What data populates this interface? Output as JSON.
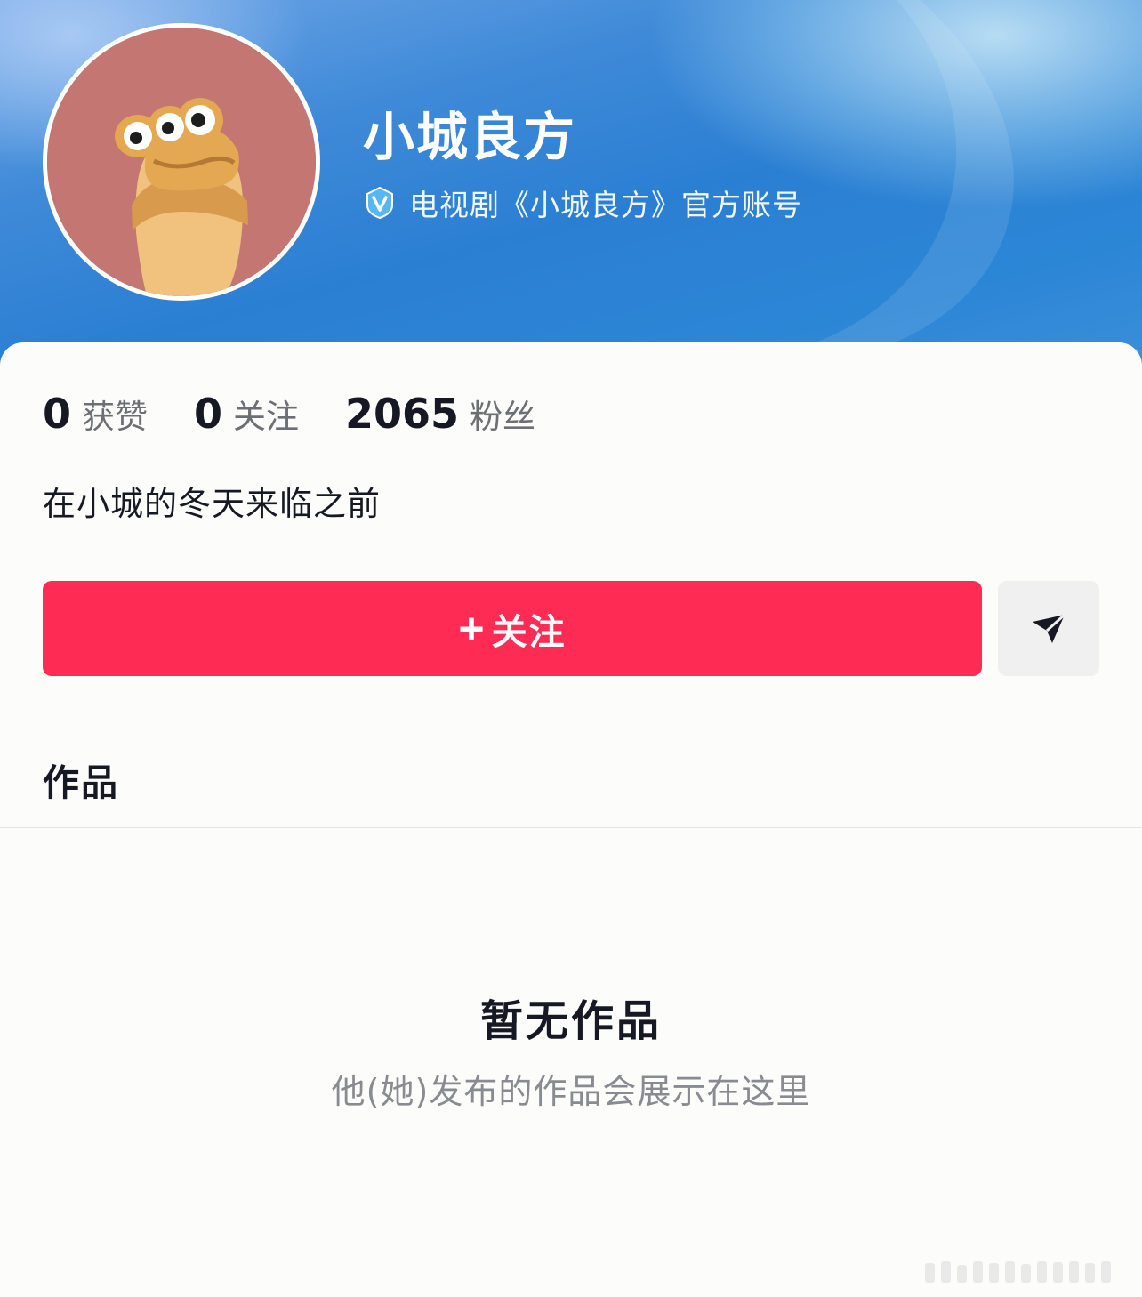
{
  "profile": {
    "name": "小城良方",
    "verify_text": "电视剧《小城良方》官方账号",
    "bio": "在小城的冬天来临之前",
    "avatar_icon": "cartoon-creature-avatar",
    "verify_icon": "verified-v-icon"
  },
  "stats": [
    {
      "value": "0",
      "label": "获赞"
    },
    {
      "value": "0",
      "label": "关注"
    },
    {
      "value": "2065",
      "label": "粉丝"
    }
  ],
  "actions": {
    "follow_plus": "+",
    "follow_label": "关注",
    "share_icon": "send-arrow-icon"
  },
  "tabs": {
    "works": "作品"
  },
  "empty_state": {
    "title": "暂无作品",
    "description": "他(她)发布的作品会展示在这里"
  },
  "colors": {
    "accent": "#fe2c55",
    "header_blue": "#2b7fd3",
    "text_primary": "#161823",
    "text_secondary": "#8a8b91"
  }
}
